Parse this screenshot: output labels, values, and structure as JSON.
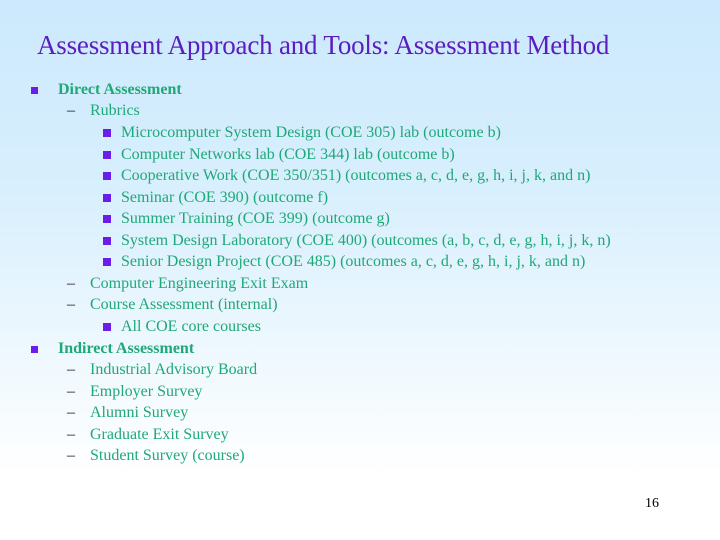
{
  "slide": {
    "title": "Assessment Approach and Tools: Assessment Method",
    "page_number": "16",
    "colors": {
      "title": "#5a1ebe",
      "body_text": "#1fa878",
      "bullet": "#6a1ee8"
    },
    "direct": {
      "label": "Direct Assessment",
      "rubrics": {
        "label": "Rubrics",
        "items": [
          "Microcomputer System Design (COE 305) lab  (outcome b)",
          "Computer Networks lab (COE 344) lab (outcome b)",
          "Cooperative Work (COE 350/351) (outcomes a, c, d, e, g, h, i, j, k, and n)",
          "Seminar (COE 390) (outcome f)",
          "Summer Training (COE 399) (outcome g)",
          "System Design Laboratory (COE 400) (outcomes (a, b, c, d, e, g, h, i, j, k, n)",
          "Senior Design Project (COE 485) (outcomes a, c, d, e, g, h, i, j, k, and n)"
        ]
      },
      "exit_exam": "Computer Engineering  Exit  Exam",
      "course_assessment": {
        "label": "Course Assessment (internal)",
        "items": [
          "All COE core courses"
        ]
      }
    },
    "indirect": {
      "label": "Indirect Assessment",
      "items": [
        "Industrial Advisory Board",
        "Employer Survey",
        "Alumni Survey",
        "Graduate Exit  Survey",
        "Student Survey (course)"
      ]
    }
  }
}
